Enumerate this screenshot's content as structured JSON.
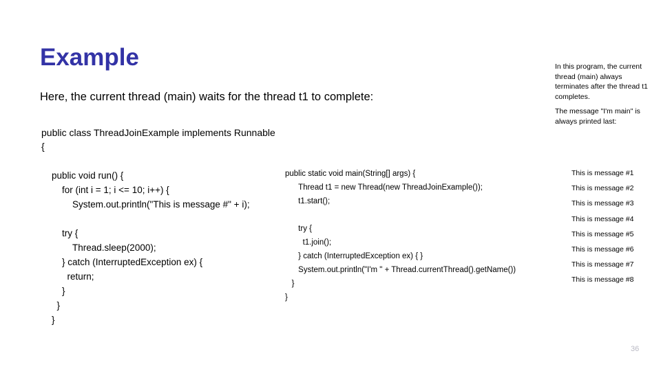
{
  "slide": {
    "title": "Example",
    "subtitle": "Here, the current thread (main) waits for the thread t1 to complete:",
    "class_declaration": "public class ThreadJoinExample implements Runnable {",
    "code_left": "    public void run() {\n        for (int i = 1; i <= 10; i++) {\n            System.out.println(\"This is message #\" + i);\n\n        try {\n            Thread.sleep(2000);\n        } catch (InterruptedException ex) {\n          return;\n        }\n      }\n    }",
    "code_middle": "public static void main(String[] args) {\n      Thread t1 = new Thread(new ThreadJoinExample());\n      t1.start();\n\n      try {\n        t1.join();\n      } catch (InterruptedException ex) { }\n      System.out.println(\"I'm \" + Thread.currentThread().getName())\n   }\n}",
    "page_number": "36"
  },
  "sidebar": {
    "paragraphs": [
      "In this program, the current thread (main) always terminates after the thread t1 completes.",
      "The message \"I'm main\" is always printed last:"
    ]
  },
  "output": {
    "messages": [
      "This is message #1",
      "This is message #2",
      "This is message #3",
      "This is message #4",
      "This is message #5",
      "This is message #6",
      "This is message #7",
      "This is message #8"
    ]
  },
  "colors": {
    "title": "#3333a6",
    "body_text": "#000000",
    "page_number": "#b9b9c4",
    "background": "#ffffff"
  }
}
